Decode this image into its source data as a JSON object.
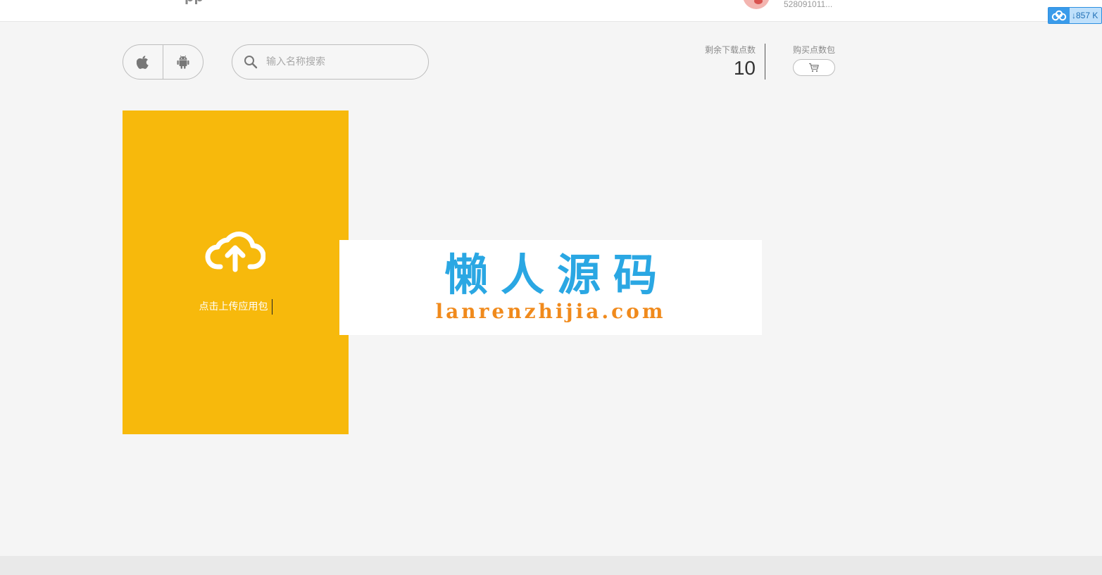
{
  "header": {
    "logo_fragment": "pp",
    "username": "528091011...",
    "extension_badge": {
      "label": "857 K",
      "icon": "cloud-download-icon"
    }
  },
  "toolbar": {
    "platforms": [
      {
        "name": "iOS",
        "icon": "apple-icon"
      },
      {
        "name": "Android",
        "icon": "android-icon"
      }
    ],
    "search": {
      "placeholder": "输入名称搜索",
      "value": ""
    }
  },
  "stats": {
    "remaining_label": "剩余下载点数",
    "remaining_value": "10",
    "buy_label": "购买点数包",
    "buy_icon": "cart-icon"
  },
  "upload": {
    "label": "点击上传应用包",
    "icon": "cloud-upload-icon",
    "color": "#f7b90c"
  },
  "watermark": {
    "title": "懒人源码",
    "url": "lanrenzhijia.com",
    "title_color": "#2aa7e3",
    "url_color": "#f08a1c"
  }
}
